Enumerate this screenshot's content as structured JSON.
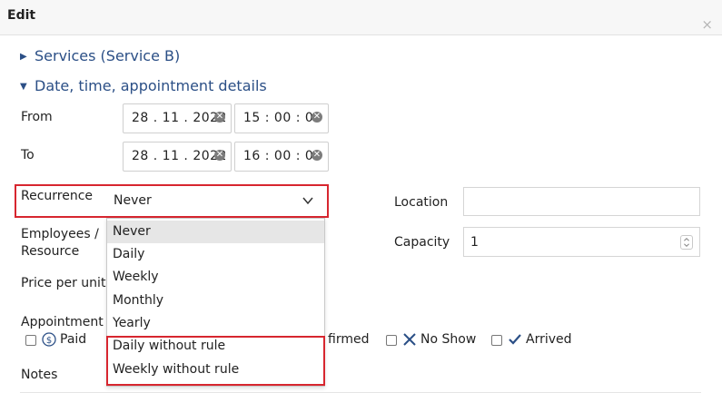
{
  "dialog": {
    "title": "Edit",
    "close_icon": "×"
  },
  "sections": [
    {
      "label": "Services (Service B)",
      "expanded": false
    },
    {
      "label": "Date, time, appointment details",
      "expanded": true
    }
  ],
  "from": {
    "label": "From",
    "date": "28 . 11 . 2022",
    "time": "15 : 00 : 00"
  },
  "to": {
    "label": "To",
    "date": "28 . 11 . 2022",
    "time": "16 : 00 : 00"
  },
  "recurrence": {
    "label": "Recurrence",
    "selected": "Never",
    "options": [
      "Never",
      "Daily",
      "Weekly",
      "Monthly",
      "Yearly",
      "Daily without rule",
      "Weekly without rule"
    ],
    "highlight_color": "#d7262f"
  },
  "employees": {
    "label_line1": "Employees /",
    "label_line2": "Resource"
  },
  "price": {
    "label": "Price per unit"
  },
  "appointment": {
    "label": "Appointment a",
    "checkboxes": [
      {
        "label": "Paid",
        "icon": "dollar-circle-icon",
        "checked": false
      },
      {
        "label": "firmed",
        "checked": false
      },
      {
        "label": "No Show",
        "icon": "x-icon",
        "checked": false
      },
      {
        "label": "Arrived",
        "icon": "check-icon",
        "checked": false
      }
    ]
  },
  "notes": {
    "label": "Notes"
  },
  "location": {
    "label": "Location",
    "value": ""
  },
  "capacity": {
    "label": "Capacity",
    "value": "1"
  },
  "colors": {
    "accent": "#2b4f86",
    "highlight": "#d7262f",
    "selected_option_bg": "#e6e6e6"
  }
}
